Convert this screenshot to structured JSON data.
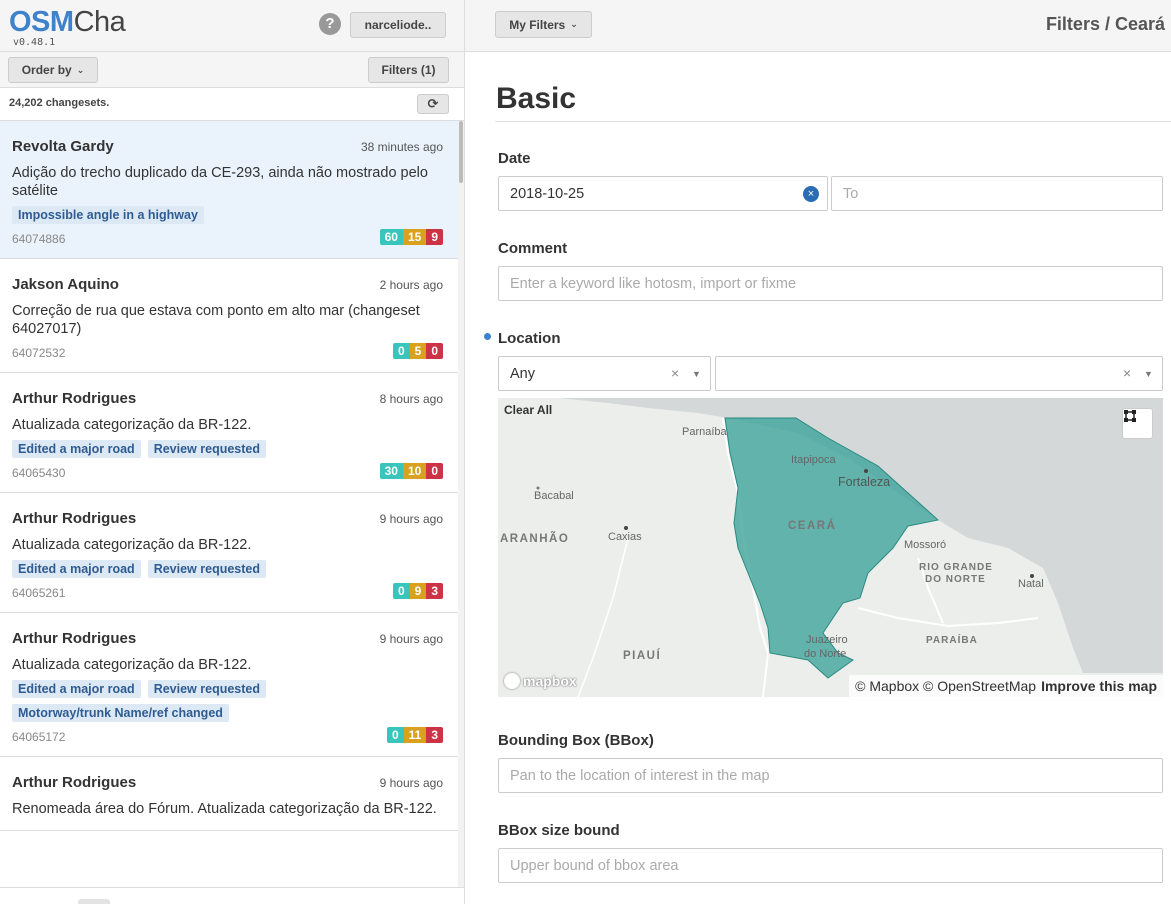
{
  "app": {
    "logo_osm": "OSM",
    "logo_cha": "Cha",
    "version": "v0.48.1",
    "help_glyph": "?",
    "user_button": "narceliode.."
  },
  "list_toolbar": {
    "order_by_label": "Order by",
    "filters_label": "Filters (1)",
    "changeset_count": "24,202 changesets.",
    "refresh_glyph": "⟳"
  },
  "changesets": [
    {
      "user": "Revolta Gardy",
      "time": "38 minutes ago",
      "comment": "Adição do trecho duplicado da CE-293, ainda não mostrado pelo satélite",
      "tags": [
        "Impossible angle in a highway"
      ],
      "id": "64074886",
      "counts": {
        "create": "60",
        "modify": "15",
        "delete": "9"
      }
    },
    {
      "user": "Jakson Aquino",
      "time": "2 hours ago",
      "comment": "Correção de rua que estava com ponto em alto mar (changeset 64027017)",
      "tags": [],
      "id": "64072532",
      "counts": {
        "create": "0",
        "modify": "5",
        "delete": "0"
      }
    },
    {
      "user": "Arthur Rodrigues",
      "time": "8 hours ago",
      "comment": "Atualizada categorização da BR-122.",
      "tags": [
        "Edited a major road",
        "Review requested"
      ],
      "id": "64065430",
      "counts": {
        "create": "30",
        "modify": "10",
        "delete": "0"
      }
    },
    {
      "user": "Arthur Rodrigues",
      "time": "9 hours ago",
      "comment": "Atualizada categorização da BR-122.",
      "tags": [
        "Edited a major road",
        "Review requested"
      ],
      "id": "64065261",
      "counts": {
        "create": "0",
        "modify": "9",
        "delete": "3"
      }
    },
    {
      "user": "Arthur Rodrigues",
      "time": "9 hours ago",
      "comment": "Atualizada categorização da BR-122.",
      "tags": [
        "Edited a major road",
        "Review requested",
        "Motorway/trunk Name/ref changed"
      ],
      "id": "64065172",
      "counts": {
        "create": "0",
        "modify": "11",
        "delete": "3"
      }
    },
    {
      "user": "Arthur Rodrigues",
      "time": "9 hours ago",
      "comment": "Renomeada área do Fórum. Atualizada categorização da BR-122.",
      "tags": [],
      "id": "",
      "counts": null
    }
  ],
  "filters": {
    "my_filters_label": "My Filters",
    "breadcrumb": "Filters / Ceará",
    "section_title": "Basic",
    "date_label": "Date",
    "date_from_value": "2018-10-25",
    "date_clear_glyph": "×",
    "date_to_placeholder": "To",
    "comment_label": "Comment",
    "comment_placeholder": "Enter a keyword like hotosm, import or fixme",
    "location_label": "Location",
    "location_type_value": "Any",
    "location_value": "",
    "clear_all_label": "Clear All",
    "bbox_label": "Bounding Box (BBox)",
    "bbox_placeholder": "Pan to the location of interest in the map",
    "bbox_size_label": "BBox size bound",
    "bbox_size_placeholder": "Upper bound of bbox area"
  },
  "map": {
    "fill_color": "#3aa39a",
    "labels": {
      "parnaiba": "Parnaíba",
      "itapipoca": "Itapipoca",
      "fortaleza": "Fortaleza",
      "bacabal": "Bacabal",
      "ceara": "CEARÁ",
      "maranhao": "ARANHÃO",
      "caxias": "Caxias",
      "mossoro": "Mossoró",
      "rgn_1": "RIO GRANDE",
      "rgn_2": "DO NORTE",
      "natal": "Natal",
      "paraiba": "PARAÍBA",
      "juazeiro_1": "Juazeiro",
      "juazeiro_2": "do Norte",
      "piaui": "PIAUÍ"
    },
    "logo_text": "mapbox",
    "attribution": "© Mapbox © OpenStreetMap",
    "improve": "Improve this map"
  }
}
